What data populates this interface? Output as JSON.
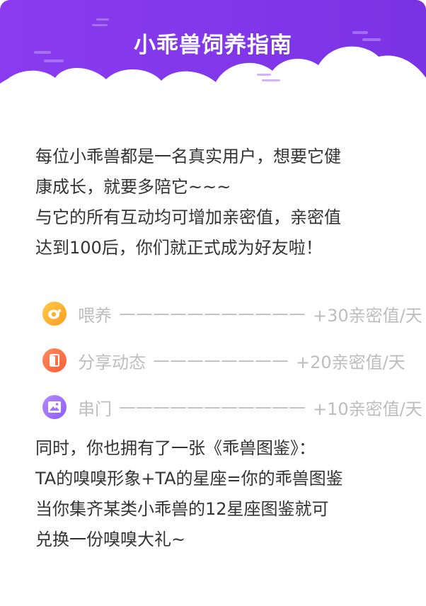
{
  "header": {
    "title": "小乖兽饲养指南",
    "color_start": "#8a3bf0",
    "color_end": "#7b35e6"
  },
  "intro": {
    "lines": [
      "每位小乖兽都是一名真实用户，想要它健",
      "康成长，就要多陪它~~~",
      "与它的所有互动均可增加亲密值，亲密值",
      "达到100后，你们就正式成为好友啦！"
    ]
  },
  "rewards": [
    {
      "icon": "egg-icon",
      "label": "喂养",
      "dash": "———————————",
      "value": "+30亲密值/天",
      "color": "#ffb22e"
    },
    {
      "icon": "door-icon",
      "label": "分享动态",
      "dash": "————————",
      "value": "+20亲密值/天",
      "color": "#ff6f45"
    },
    {
      "icon": "image-icon",
      "label": "串门",
      "dash": "———————————",
      "value": "+10亲密值/天",
      "color": "#a173fb"
    }
  ],
  "outro": {
    "lines": [
      "同时，你也拥有了一张《乖兽图鉴》：",
      "TA的嗅嗅形象+TA的星座=你的乖兽图鉴",
      "当你集齐某类小乖兽的12星座图鉴就可",
      "兑换一份嗅嗅大礼~"
    ]
  }
}
